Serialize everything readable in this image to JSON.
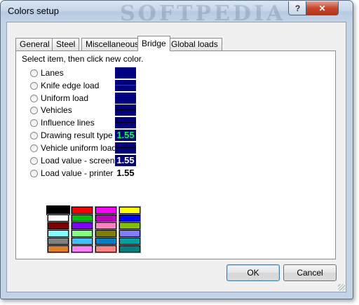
{
  "window": {
    "title": "Colors setup",
    "watermark": "SOFTPEDIA",
    "help_label": "?",
    "close_label": "✕"
  },
  "tabs": [
    {
      "label": "General",
      "active": false
    },
    {
      "label": "Steel",
      "active": false
    },
    {
      "label": "Miscellaneous",
      "active": false
    },
    {
      "label": "Bridge",
      "active": true
    },
    {
      "label": "Global loads",
      "active": false
    }
  ],
  "panel": {
    "instruction": "Select item, then click new color.",
    "options": [
      {
        "label": "Lanes",
        "color": "#000080"
      },
      {
        "label": "Knife edge load",
        "color": "#000080"
      },
      {
        "label": "Uniform load",
        "color": "#000080"
      },
      {
        "label": "Vehicles",
        "color": "#000080"
      },
      {
        "label": "Influence lines",
        "color": "#000080"
      },
      {
        "label": "Drawing result type",
        "sample": "1.55"
      },
      {
        "label": "Vehicle uniform load",
        "color": "#000080"
      },
      {
        "label": "Load value - screen",
        "sample": "1.55"
      },
      {
        "label": "Load value - printer",
        "sample": "1.55"
      }
    ],
    "palette": [
      [
        "#000000",
        "#ff0000",
        "#ff00ff",
        "#ffff00"
      ],
      [
        "#ffffff",
        "#00c000",
        "#c000c0",
        "#0000ff"
      ],
      [
        "#800000",
        "#8000ff",
        "#ff80c0",
        "#80c000"
      ],
      [
        "#80ffff",
        "#80ff80",
        "#808000",
        "#8080ff"
      ],
      [
        "#808080",
        "#40c0ff",
        "#0080c0",
        "#00a0a0"
      ],
      [
        "#e08020",
        "#ff80ff",
        "#ff8080",
        "#008080"
      ]
    ]
  },
  "buttons": {
    "ok": "OK",
    "cancel": "Cancel"
  }
}
